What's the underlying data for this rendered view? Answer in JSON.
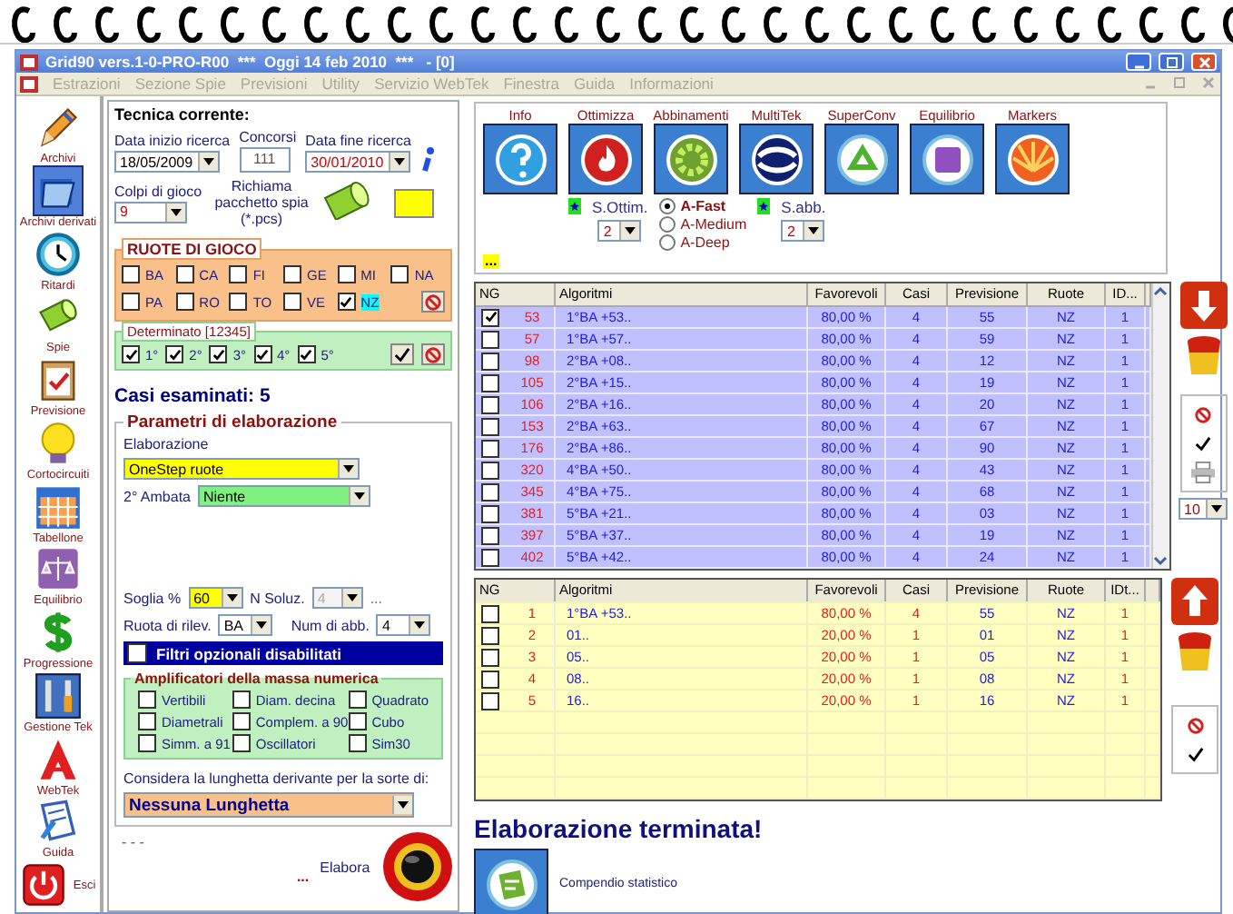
{
  "window": {
    "title": "Grid90 vers.1-0-PRO-R00  ***  Oggi 14 feb 2010  ***   - [0]"
  },
  "menu": [
    {
      "label": "Estrazioni",
      "disabled": true
    },
    {
      "label": "Sezione Spie",
      "disabled": true
    },
    {
      "label": "Previsioni",
      "disabled": true
    },
    {
      "label": "Utility",
      "disabled": true
    },
    {
      "label": "Servizio WebTek",
      "disabled": true
    },
    {
      "label": "Finestra",
      "disabled": true
    },
    {
      "label": "Guida",
      "disabled": true
    },
    {
      "label": "Informazioni",
      "disabled": true
    }
  ],
  "sidebar": [
    {
      "label": "Archivi",
      "selected": false
    },
    {
      "label": "Archivi derivati",
      "selected": true
    },
    {
      "label": "Ritardi",
      "selected": false
    },
    {
      "label": "Spie",
      "selected": false
    },
    {
      "label": "Previsione",
      "selected": false
    },
    {
      "label": "Cortocircuiti",
      "selected": false
    },
    {
      "label": "Tabellone",
      "selected": false
    },
    {
      "label": "Equilibrio",
      "selected": false
    },
    {
      "label": "Progressione",
      "selected": false
    },
    {
      "label": "Gestione Tek",
      "selected": false
    },
    {
      "label": "WebTek",
      "selected": false
    },
    {
      "label": "Guida",
      "selected": false
    },
    {
      "label": "Esci",
      "selected": false
    }
  ],
  "technique": {
    "title": "Tecnica corrente:",
    "start": {
      "label": "Data inizio ricerca",
      "value": "18/05/2009"
    },
    "draws": {
      "label": "Concorsi",
      "value": "111"
    },
    "end": {
      "label": "Data fine ricerca",
      "value": "30/01/2010"
    },
    "colpi": {
      "label": "Colpi di gioco",
      "value": "9"
    },
    "spy_label": "Richiama pacchetto spia (*.pcs)",
    "wheels": {
      "title": "RUOTE DI GIOCO",
      "items": [
        {
          "label": "BA",
          "checked": false
        },
        {
          "label": "CA",
          "checked": false
        },
        {
          "label": "FI",
          "checked": false
        },
        {
          "label": "GE",
          "checked": false
        },
        {
          "label": "MI",
          "checked": false
        },
        {
          "label": "NA",
          "checked": false
        },
        {
          "label": "PA",
          "checked": false
        },
        {
          "label": "RO",
          "checked": false
        },
        {
          "label": "TO",
          "checked": false
        },
        {
          "label": "VE",
          "checked": false
        },
        {
          "label": "NZ",
          "checked": true
        }
      ]
    },
    "determinato": {
      "title": "Determinato [12345]",
      "items": [
        {
          "label": "1°",
          "checked": true
        },
        {
          "label": "2°",
          "checked": true
        },
        {
          "label": "3°",
          "checked": true
        },
        {
          "label": "4°",
          "checked": true
        },
        {
          "label": "5°",
          "checked": true
        }
      ]
    },
    "cases": "Casi esaminati: 5"
  },
  "params": {
    "title": "Parametri di elaborazione",
    "elaborazione": {
      "label": "Elaborazione",
      "value": "OneStep ruote"
    },
    "ambata": {
      "label": "2° Ambata",
      "value": "Niente"
    },
    "soglia": {
      "label": "Soglia %",
      "value": "60"
    },
    "soluzioni": {
      "label": "N Soluz.",
      "value": "4",
      "disabled": true
    },
    "soluzioni_more": "...",
    "ruota": {
      "label": "Ruota di rilev.",
      "value": "BA"
    },
    "abbinamenti": {
      "label": "Num di abb.",
      "value": "4"
    },
    "filter": {
      "label": "Filtri opzionali disabilitati",
      "checked": false
    },
    "amplifiers": {
      "title": "Amplificatori della massa numerica",
      "items": [
        {
          "label": "Vertibili",
          "checked": false
        },
        {
          "label": "Diam. decina",
          "checked": false
        },
        {
          "label": "Quadrato",
          "checked": false
        },
        {
          "label": "Diametrali",
          "checked": false
        },
        {
          "label": "Complem. a 90",
          "checked": false
        },
        {
          "label": "Cubo",
          "checked": false
        },
        {
          "label": "Simm. a 91",
          "checked": false
        },
        {
          "label": "Oscillatori",
          "checked": false
        },
        {
          "label": "Sim30",
          "checked": false
        }
      ]
    },
    "lunghetta": {
      "label": "Considera la lunghetta derivante per la sorte di:",
      "value": "Nessuna Lunghetta"
    }
  },
  "run": {
    "dashes": "- - -",
    "dots": "...",
    "label": "Elabora"
  },
  "tools": {
    "buttons": [
      "Info",
      "Ottimizza",
      "Abbinamenti",
      "MultiTek",
      "SuperConv",
      "Equilibrio",
      "Markers"
    ],
    "opt_label": "S.Ottim.",
    "opt_value": "2",
    "modes": [
      {
        "label": "A-Fast",
        "selected": true
      },
      {
        "label": "A-Medium",
        "selected": false
      },
      {
        "label": "A-Deep",
        "selected": false
      }
    ],
    "abb_label": "S.abb.",
    "abb_value": "2",
    "more": "..."
  },
  "results": {
    "columns": [
      "NG",
      "Algoritmi",
      "Favorevoli",
      "Casi",
      "Previsione",
      "Ruote",
      "ID..."
    ],
    "rows": [
      {
        "checked": true,
        "cells": [
          "53",
          "1°BA +53..",
          "80,00 %",
          "4",
          "55",
          "NZ",
          "1"
        ]
      },
      {
        "checked": false,
        "cells": [
          "57",
          "1°BA +57..",
          "80,00 %",
          "4",
          "59",
          "NZ",
          "1"
        ]
      },
      {
        "checked": false,
        "cells": [
          "98",
          "2°BA +08..",
          "80,00 %",
          "4",
          "12",
          "NZ",
          "1"
        ]
      },
      {
        "checked": false,
        "cells": [
          "105",
          "2°BA +15..",
          "80,00 %",
          "4",
          "19",
          "NZ",
          "1"
        ]
      },
      {
        "checked": false,
        "cells": [
          "106",
          "2°BA +16..",
          "80,00 %",
          "4",
          "20",
          "NZ",
          "1"
        ]
      },
      {
        "checked": false,
        "cells": [
          "153",
          "2°BA +63..",
          "80,00 %",
          "4",
          "67",
          "NZ",
          "1"
        ]
      },
      {
        "checked": false,
        "cells": [
          "176",
          "2°BA +86..",
          "80,00 %",
          "4",
          "90",
          "NZ",
          "1"
        ]
      },
      {
        "checked": false,
        "cells": [
          "320",
          "4°BA +50..",
          "80,00 %",
          "4",
          "43",
          "NZ",
          "1"
        ]
      },
      {
        "checked": false,
        "cells": [
          "345",
          "4°BA +75..",
          "80,00 %",
          "4",
          "68",
          "NZ",
          "1"
        ]
      },
      {
        "checked": false,
        "cells": [
          "381",
          "5°BA +21..",
          "80,00 %",
          "4",
          "03",
          "NZ",
          "1"
        ]
      },
      {
        "checked": false,
        "cells": [
          "397",
          "5°BA +37..",
          "80,00 %",
          "4",
          "19",
          "NZ",
          "1"
        ]
      },
      {
        "checked": false,
        "cells": [
          "402",
          "5°BA +42..",
          "80,00 %",
          "4",
          "24",
          "NZ",
          "1"
        ]
      }
    ],
    "page_size": "10"
  },
  "selection": {
    "columns": [
      "NG",
      "Algoritmi",
      "Favorevoli",
      "Casi",
      "Previsione",
      "Ruote",
      "IDt..."
    ],
    "rows": [
      {
        "checked": false,
        "cells": [
          "1",
          "1°BA +53..",
          "80,00 %",
          "4",
          "55",
          "NZ",
          "1"
        ]
      },
      {
        "checked": false,
        "cells": [
          "2",
          "01..",
          "20,00 %",
          "1",
          "01",
          "NZ",
          "1"
        ]
      },
      {
        "checked": false,
        "cells": [
          "3",
          "05..",
          "20,00 %",
          "1",
          "05",
          "NZ",
          "1"
        ]
      },
      {
        "checked": false,
        "cells": [
          "4",
          "08..",
          "20,00 %",
          "1",
          "08",
          "NZ",
          "1"
        ]
      },
      {
        "checked": false,
        "cells": [
          "5",
          "16..",
          "20,00 %",
          "1",
          "16",
          "NZ",
          "1"
        ]
      }
    ]
  },
  "status": "Elaborazione terminata!",
  "summary_label": "Compendio statistico"
}
